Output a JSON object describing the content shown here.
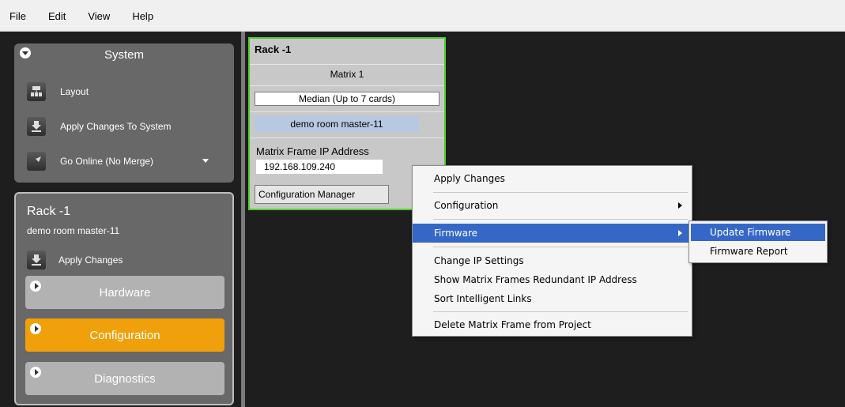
{
  "menubar": {
    "items": [
      "File",
      "Edit",
      "View",
      "Help"
    ]
  },
  "system": {
    "title": "System",
    "items": [
      {
        "label": "Layout",
        "icon": "layout-icon"
      },
      {
        "label": "Apply Changes To System",
        "icon": "apply-changes-icon"
      },
      {
        "label": "Go Online (No Merge)",
        "icon": "go-online-icon"
      }
    ]
  },
  "rack_panel": {
    "title": "Rack -1",
    "subtitle": "demo room master-11",
    "apply_label": "Apply Changes",
    "sections": [
      {
        "label": "Hardware",
        "active": false
      },
      {
        "label": "Configuration",
        "active": true
      },
      {
        "label": "Diagnostics",
        "active": false
      }
    ],
    "active_color": "#f0a00a"
  },
  "rack_card": {
    "title": "Rack -1",
    "matrix": "Matrix 1",
    "median": "Median (Up to 7 cards)",
    "room": "demo room master-11",
    "ip_label": "Matrix Frame IP Address",
    "ip_value": "192.168.109.240",
    "config_button": "Configuration Manager",
    "border_color": "#4fcf2a"
  },
  "context_menu": {
    "items": [
      {
        "label": "Apply Changes"
      },
      {
        "label": "Configuration",
        "submenu": true
      },
      {
        "label": "Firmware",
        "submenu": true,
        "highlighted": true
      },
      {
        "label": "Change IP Settings"
      },
      {
        "label": "Show Matrix Frames Redundant IP Address"
      },
      {
        "label": "Sort Intelligent Links"
      },
      {
        "label": "Delete Matrix Frame from Project"
      }
    ],
    "highlight_color": "#3568c6"
  },
  "firmware_submenu": {
    "items": [
      {
        "label": "Update Firmware",
        "highlighted": true
      },
      {
        "label": "Firmware Report"
      }
    ]
  }
}
